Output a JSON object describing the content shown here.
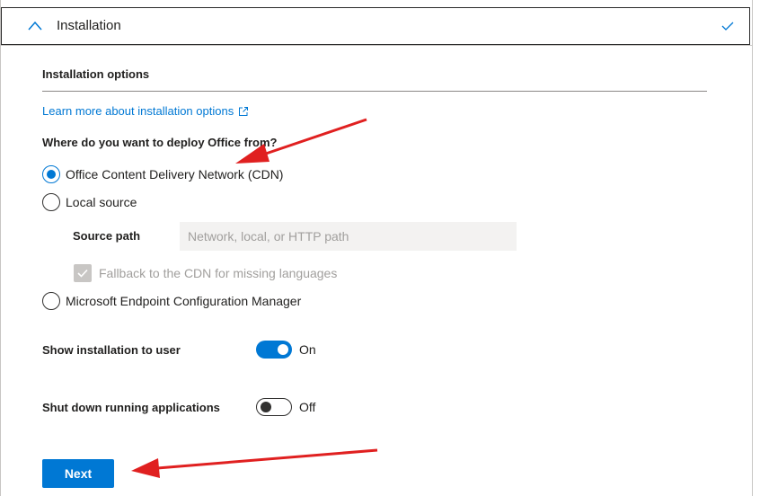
{
  "section": {
    "title": "Installation"
  },
  "options": {
    "group_title": "Installation options",
    "learn_more_link": "Learn more about installation options",
    "question": "Where do you want to deploy Office from?",
    "radio_cdn": "Office Content Delivery Network (CDN)",
    "radio_local": "Local source",
    "source_path_label": "Source path",
    "source_path_placeholder": "Network, local, or HTTP path",
    "source_path_value": "",
    "fallback_checkbox": "Fallback to the CDN for missing languages",
    "radio_mecm": "Microsoft Endpoint Configuration Manager",
    "selected_source": "Office Content Delivery Network (CDN)"
  },
  "toggles": {
    "show_install_label": "Show installation to user",
    "show_install_state": "On",
    "shutdown_label": "Shut down running applications",
    "shutdown_state": "Off"
  },
  "footer": {
    "next_label": "Next"
  },
  "colors": {
    "accent": "#0078d4",
    "annotation_arrow": "#e02020"
  },
  "icons": [
    "chevron-up-icon",
    "checkmark-icon",
    "external-link-icon",
    "red-arrow-annotation"
  ]
}
